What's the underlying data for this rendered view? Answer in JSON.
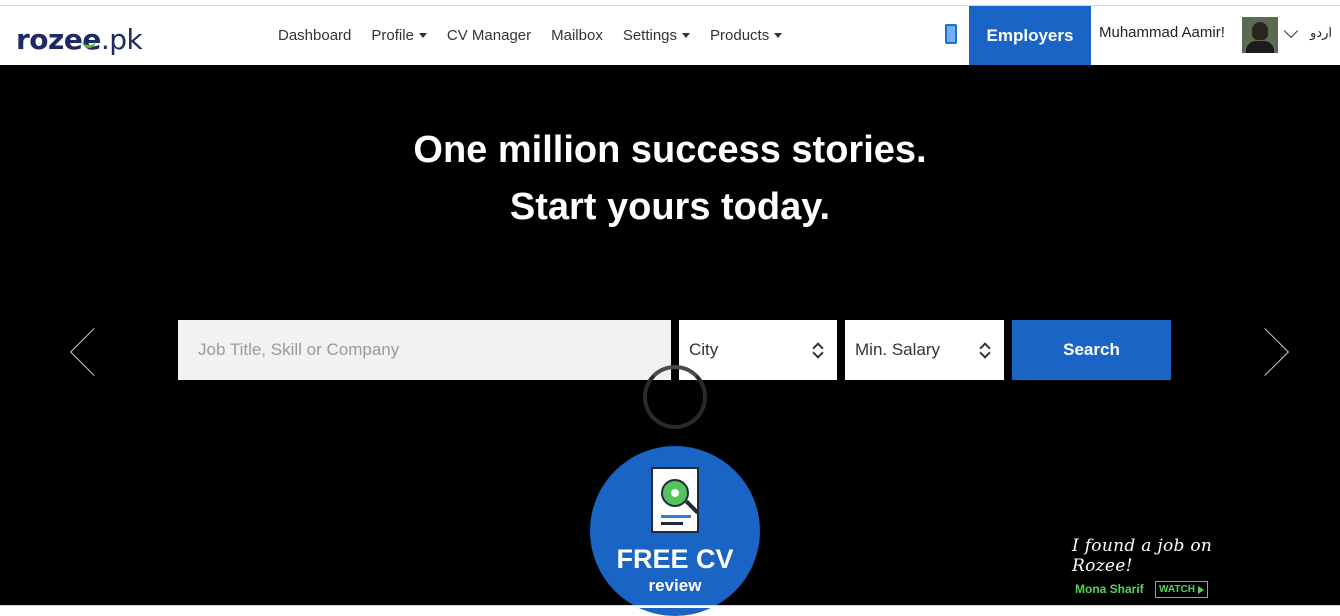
{
  "header": {
    "logo": {
      "brand": "rozee",
      "tld": ".pk"
    },
    "nav": [
      {
        "label": "Dashboard",
        "dropdown": false
      },
      {
        "label": "Profile",
        "dropdown": true
      },
      {
        "label": "CV Manager",
        "dropdown": false
      },
      {
        "label": "Mailbox",
        "dropdown": false
      },
      {
        "label": "Settings",
        "dropdown": true
      },
      {
        "label": "Products",
        "dropdown": true
      }
    ],
    "mobile_icon": "mobile-phone-icon",
    "employers_label": "Employers",
    "user_name": "Muhammad Aamir!",
    "language_link": "اردو"
  },
  "hero": {
    "headline_line1": "One million success stories.",
    "headline_line2": "Start yours today.",
    "search": {
      "keyword_placeholder": "Job Title, Skill or Company",
      "keyword_value": "",
      "city_selected": "City",
      "salary_selected": "Min. Salary",
      "button_label": "Search"
    },
    "cv_badge": {
      "icon": "cv-review-icon",
      "title": "FREE CV",
      "subtitle": "review"
    },
    "testimonial": {
      "quote": "I found a job on Rozee!",
      "name": "Mona Sharif",
      "watch_label": "WATCH"
    }
  },
  "colors": {
    "accent_blue": "#1a64c5",
    "brand_navy": "#1e2a63",
    "brand_green": "#57b846",
    "testimonial_green": "#58d05b",
    "hero_background": "#000000"
  }
}
